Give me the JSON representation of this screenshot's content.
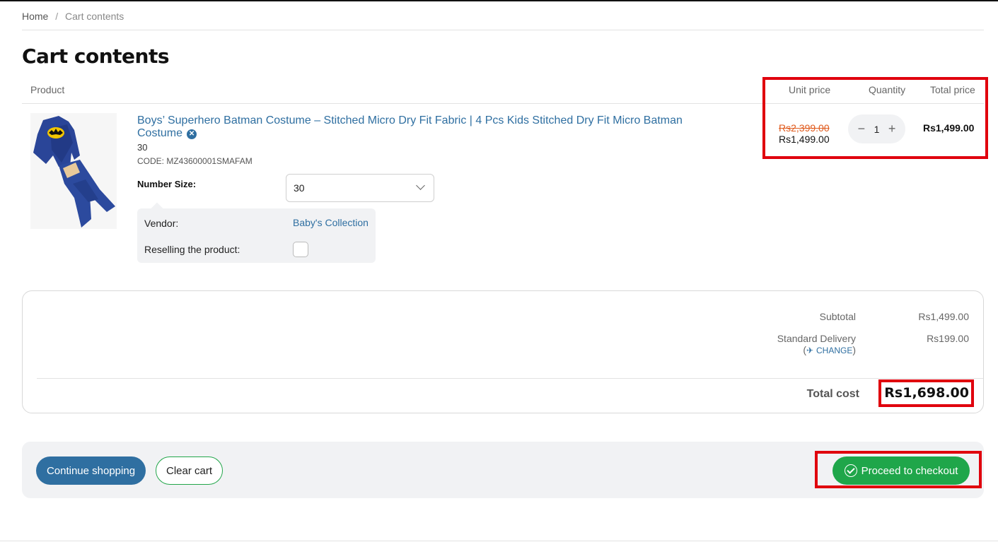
{
  "breadcrumb": {
    "home": "Home",
    "separator": "/",
    "current": "Cart contents"
  },
  "page_title": "Cart contents",
  "table_headers": {
    "product": "Product",
    "unit_price": "Unit price",
    "quantity": "Quantity",
    "total_price": "Total price"
  },
  "item": {
    "name": "Boys’ Superhero Batman Costume – Stitched Micro Dry Fit Fabric | 4 Pcs Kids Stitched Dry Fit Micro Batman Costume",
    "option_value": "30",
    "code": "CODE: MZ43600001SMAFAM",
    "size_label": "Number Size:",
    "size_selected": "30",
    "vendor_label": "Vendor:",
    "vendor_name": "Baby's Collection",
    "reselling_label": "Reselling the product:",
    "reselling_checked": false,
    "old_price": "Rs2,399.00",
    "unit_price": "Rs1,499.00",
    "quantity": "1",
    "qty_minus": "−",
    "qty_plus": "+",
    "total_price": "Rs1,499.00"
  },
  "summary": {
    "subtotal_label": "Subtotal",
    "subtotal_value": "Rs1,499.00",
    "delivery_label": "Standard Delivery",
    "delivery_value": "Rs199.00",
    "change_open": "(",
    "change_icon": "✈",
    "change_label": "CHANGE",
    "change_close": ")",
    "total_label": "Total cost",
    "total_value": "Rs1,698.00"
  },
  "actions": {
    "continue_label": "Continue shopping",
    "clear_label": "Clear cart",
    "checkout_label": "Proceed to checkout"
  },
  "colors": {
    "link": "#2f6fa1",
    "accent_green": "#1fa64a",
    "strike_price": "#e05a1c",
    "highlight": "#e0000d"
  },
  "icons": {
    "remove": "remove-icon",
    "chevron": "chevron-down-icon",
    "plane": "plane-icon",
    "check": "check-circle-icon"
  }
}
